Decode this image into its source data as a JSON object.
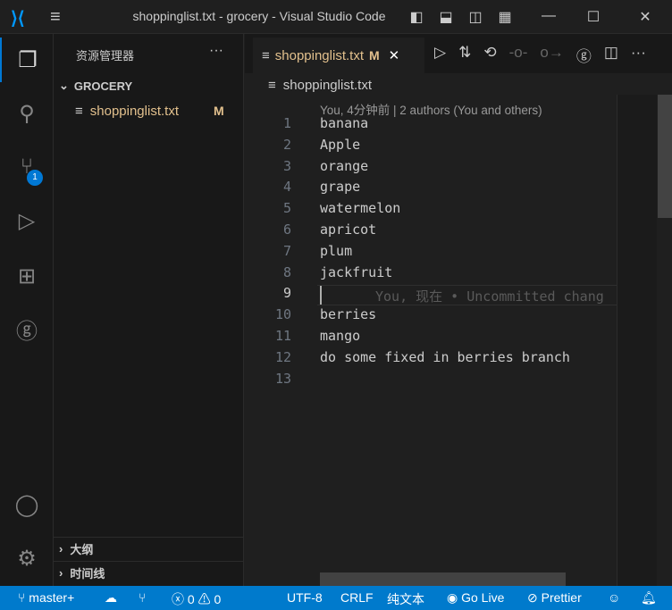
{
  "window": {
    "title": "shoppinglist.txt - grocery - Visual Studio Code"
  },
  "sidebar": {
    "title": "资源管理器",
    "more": "···",
    "folder": "GROCERY",
    "files": [
      {
        "name": "shoppinglist.txt",
        "status": "M"
      }
    ],
    "outline": "大纲",
    "timeline": "时间线"
  },
  "activity": {
    "scm_badge": "1"
  },
  "tab": {
    "label": "shoppinglist.txt",
    "status": "M",
    "close": "✕"
  },
  "breadcrumb": "shoppinglist.txt",
  "codelens": "You, 4分钟前 | 2 authors (You and others)",
  "lines": [
    "banana",
    "Apple",
    "orange",
    "grape",
    "watermelon",
    "apricot",
    "plum",
    "jackfruit",
    "",
    "berries",
    "mango",
    "do some fixed in berries branch",
    ""
  ],
  "line_numbers": [
    "1",
    "2",
    "3",
    "4",
    "5",
    "6",
    "7",
    "8",
    "9",
    "10",
    "11",
    "12",
    "13"
  ],
  "inline_blame": "You, 现在 • Uncommitted chang",
  "status": {
    "branch": "master+",
    "errors": "0",
    "warnings": "0",
    "encoding": "UTF-8",
    "eol": "CRLF",
    "language": "纯文本",
    "golive": "Go Live",
    "prettier": "Prettier"
  },
  "colors": {
    "accent": "#007acc",
    "modified": "#e2c08d"
  }
}
